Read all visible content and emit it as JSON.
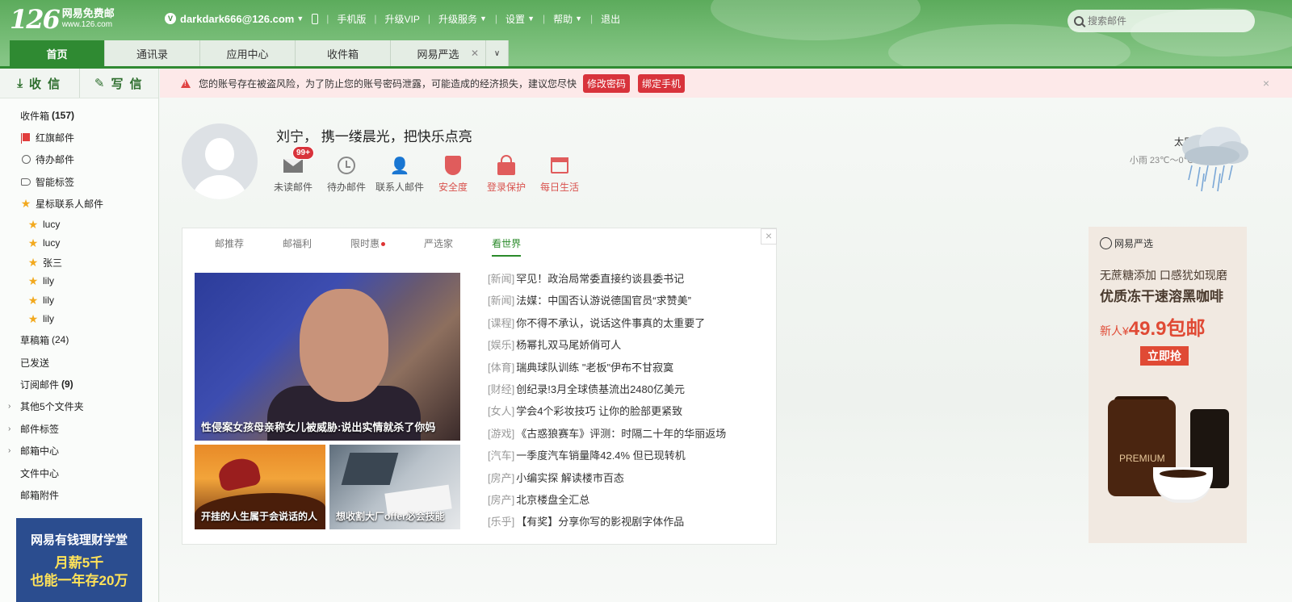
{
  "header": {
    "logo_number": "126",
    "logo_title": "网易免费邮",
    "logo_url": "www.126.com",
    "account": "darkdark666@126.com",
    "account_badge": "V",
    "nav": [
      "手机版",
      "升级VIP",
      "升级服务",
      "设置",
      "帮助",
      "退出"
    ],
    "search_placeholder": "搜索邮件"
  },
  "tabs": [
    {
      "label": "首页",
      "active": true
    },
    {
      "label": "通讯录"
    },
    {
      "label": "应用中心"
    },
    {
      "label": "收件箱"
    },
    {
      "label": "网易严选",
      "closable": true
    }
  ],
  "sidebar": {
    "receive_label": "收 信",
    "compose_label": "写 信",
    "folders": [
      {
        "label": "收件箱",
        "count": "(157)"
      },
      {
        "label": "红旗邮件",
        "icon": "flag-icon"
      },
      {
        "label": "待办邮件",
        "icon": "clock-icon"
      },
      {
        "label": "智能标签",
        "icon": "tag-icon"
      },
      {
        "label": "星标联系人邮件",
        "icon": "star-icon"
      }
    ],
    "starred": [
      "lucy",
      "lucy",
      "张三",
      "lily",
      "lily",
      "lily"
    ],
    "folders2": [
      {
        "label": "草稿箱",
        "count_plain": "(24)"
      },
      {
        "label": "已发送"
      },
      {
        "label": "订阅邮件",
        "count": "(9)"
      },
      {
        "label": "其他5个文件夹",
        "expandable": true
      },
      {
        "label": "邮件标签",
        "expandable": true
      },
      {
        "label": "邮箱中心",
        "expandable": true
      },
      {
        "label": "文件中心"
      },
      {
        "label": "邮箱附件"
      }
    ],
    "ad_line1": "网易有钱理财学堂",
    "ad_line2": "月薪5千",
    "ad_line3": "也能一年存20万"
  },
  "alert": {
    "text": "您的账号存在被盗风险，为了防止您的账号密码泄露，可能造成的经济损失，建议您尽快",
    "btn1": "修改密码",
    "btn2": "绑定手机",
    "close": "×"
  },
  "profile": {
    "greeting": "刘宁， 携一缕晨光，把快乐点亮",
    "stats": [
      {
        "label": "未读邮件",
        "badge": "99+",
        "icon": "envelope-icon"
      },
      {
        "label": "待办邮件",
        "icon": "clock-icon"
      },
      {
        "label": "联系人邮件",
        "icon": "contact-star-icon"
      },
      {
        "label": "安全度",
        "icon": "shield-icon"
      },
      {
        "label": "登录保护",
        "icon": "lock-icon"
      },
      {
        "label": "每日生活",
        "icon": "calendar-icon"
      }
    ]
  },
  "weather": {
    "city": "太原",
    "desc": "小雨 23℃～0℃",
    "icon": "rain-cloud-icon"
  },
  "news": {
    "tabs": [
      "邮推荐",
      "邮福利",
      "限时惠",
      "严选家",
      "看世界"
    ],
    "active_tab": "看世界",
    "close": "×",
    "big_caption": "性侵案女孩母亲称女儿被威胁:说出实情就杀了你妈",
    "small_captions": [
      "开挂的人生属于会说话的人",
      "想收割大厂offer必会技能"
    ],
    "items": [
      {
        "cat": "[新闻]",
        "title": "罕见！政治局常委直接约谈县委书记"
      },
      {
        "cat": "[新闻]",
        "title": "法媒：中国否认游说德国官员“求赞美”"
      },
      {
        "cat": "[课程]",
        "title": "你不得不承认，说话这件事真的太重要了"
      },
      {
        "cat": "[娱乐]",
        "title": "杨幂扎双马尾娇俏可人"
      },
      {
        "cat": "[体育]",
        "title": "瑞典球队训练 \"老板\"伊布不甘寂寞"
      },
      {
        "cat": "[财经]",
        "title": "创纪录!3月全球债基流出2480亿美元"
      },
      {
        "cat": "[女人]",
        "title": "学会4个彩妆技巧 让你的脸部更紧致"
      },
      {
        "cat": "[游戏]",
        "title": "《古惑狼赛车》评测：时隔二十年的华丽返场"
      },
      {
        "cat": "[汽车]",
        "title": "一季度汽车销量降42.4% 但已现转机"
      },
      {
        "cat": "[房产]",
        "title": "小编实探 解读楼市百态"
      },
      {
        "cat": "[房产]",
        "title": "北京楼盘全汇总"
      },
      {
        "cat": "[乐乎]",
        "title": "【有奖】分享你写的影视剧字体作品"
      }
    ]
  },
  "ad": {
    "brand": "网易严选",
    "line1": "无蔗糖添加 口感犹如现磨",
    "line2": "优质冻干速溶黑咖啡",
    "price_prefix": "新人¥",
    "price": "49.9包邮",
    "buy": "立即抢",
    "product_text": "PREMIUM"
  }
}
